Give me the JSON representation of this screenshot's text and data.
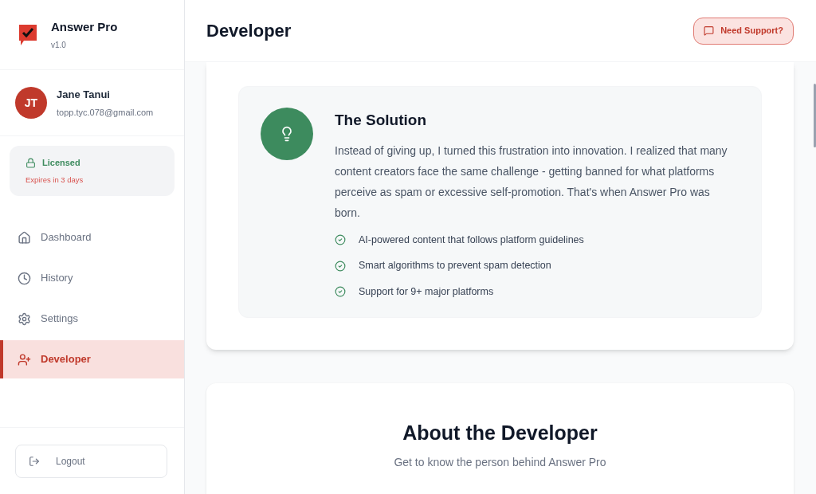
{
  "app": {
    "name": "Answer Pro",
    "version": "v1.0"
  },
  "user": {
    "initials": "JT",
    "name": "Jane Tanui",
    "email": "topp.tyc.078@gmail.com"
  },
  "license": {
    "status": "Licensed",
    "expiry": "Expires in 3 days"
  },
  "nav": [
    {
      "kind": "home",
      "label": "Dashboard",
      "selected": false
    },
    {
      "kind": "history",
      "label": "History",
      "selected": false
    },
    {
      "kind": "settings",
      "label": "Settings",
      "selected": false
    },
    {
      "kind": "developer",
      "label": "Developer",
      "selected": true
    }
  ],
  "logout": "Logout",
  "header": {
    "title": "Developer",
    "support_button": "Need Support?"
  },
  "solution": {
    "title": "The Solution",
    "body": "Instead of giving up, I turned this frustration into innovation. I realized that many content creators face the same challenge - getting banned for what platforms perceive as spam or excessive self-promotion. That's when Answer Pro was born.",
    "points": [
      "AI-powered content that follows platform guidelines",
      "Smart algorithms to prevent spam detection",
      "Support for 9+ major platforms"
    ]
  },
  "about": {
    "title": "About the Developer",
    "subtitle": "Get to know the person behind Answer Pro"
  }
}
